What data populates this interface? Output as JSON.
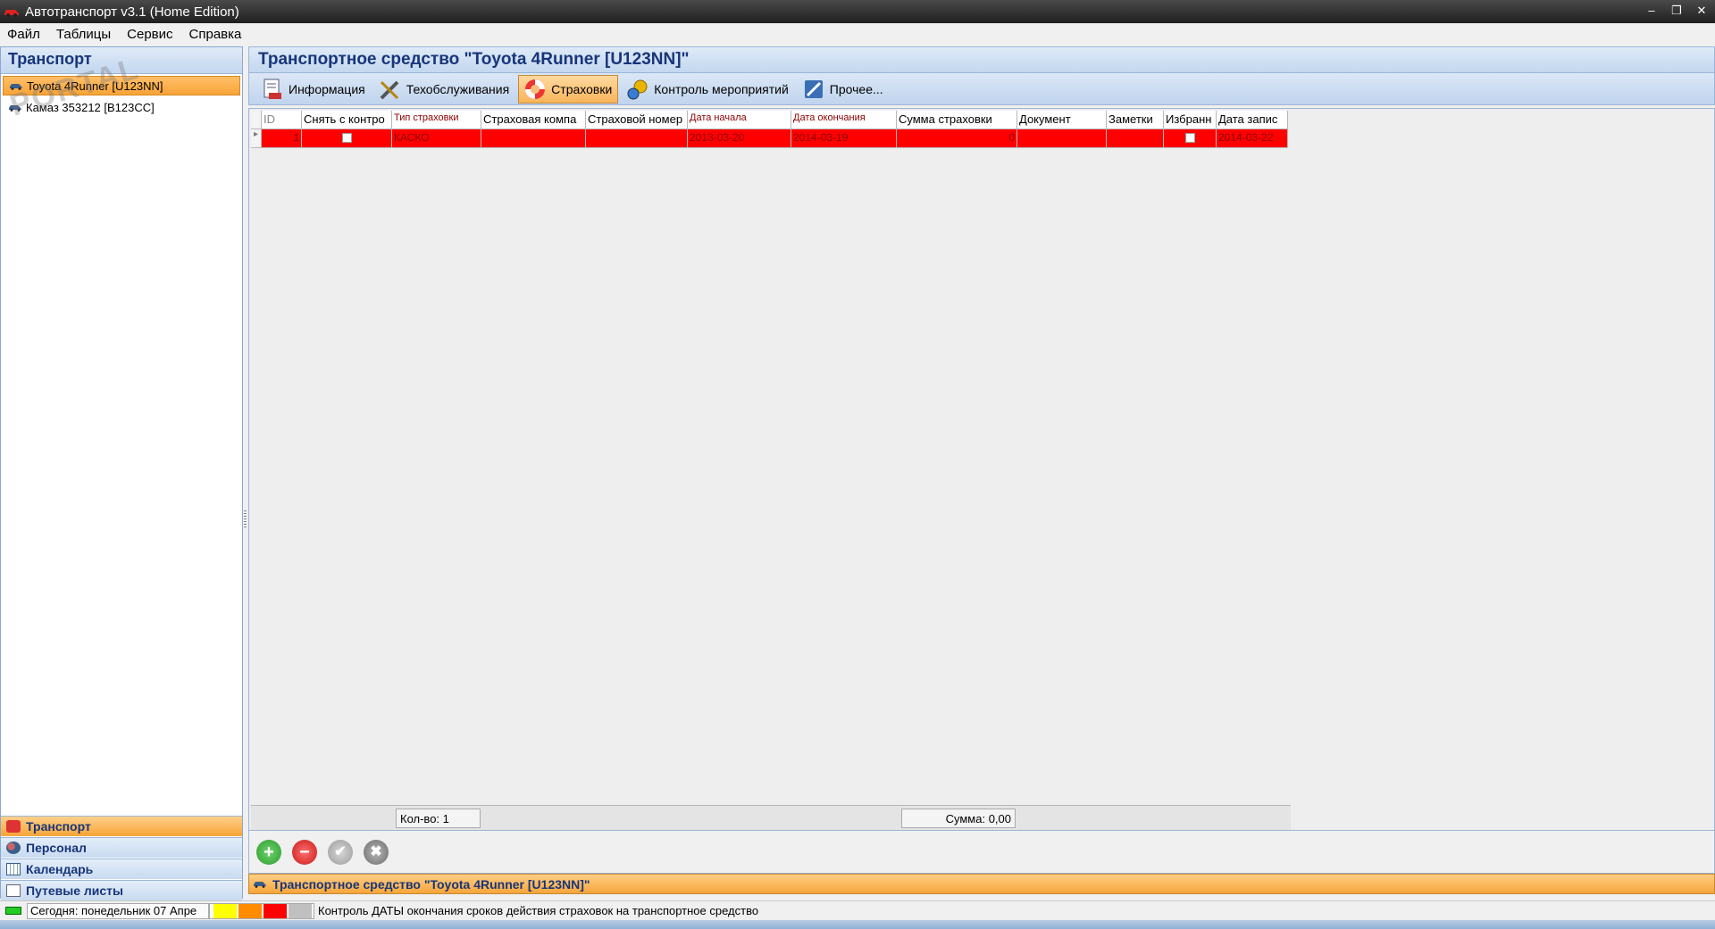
{
  "window": {
    "title": "Автотранспорт v3.1 (Home Edition)"
  },
  "menu": {
    "items": [
      "Файл",
      "Таблицы",
      "Сервис",
      "Справка"
    ]
  },
  "left": {
    "header": "Транспорт",
    "vehicles": [
      "Toyota 4Runner [U123NN]",
      "Камаз 353212 [B123CC]"
    ],
    "nav": [
      "Транспорт",
      "Персонал",
      "Календарь",
      "Путевые листы"
    ]
  },
  "right": {
    "header": "Транспортное средство \"Toyota 4Runner [U123NN]\"",
    "tabs": [
      "Информация",
      "Техобслуживания",
      "Страховки",
      "Контроль мероприятий",
      "Прочее..."
    ]
  },
  "grid": {
    "columns": [
      "ID",
      "Снять с контро",
      "Тип страховки",
      "Страховая компа",
      "Страховой номер",
      "Дата начала",
      "Дата окончания",
      "Сумма страховки",
      "Документ",
      "Заметки",
      "Избранн",
      "Дата запис"
    ],
    "row": {
      "id": "1",
      "type": "КАСКО",
      "company": "",
      "number": "",
      "start": "2013-03-20",
      "end": "2014-03-19",
      "sum": "0",
      "document": "",
      "notes": "",
      "created": "2014-03-22"
    },
    "footer": {
      "count": "Кол-во: 1",
      "sum": "Сумма: 0,00"
    }
  },
  "status_bottom": "Транспортное средство \"Toyota 4Runner [U123NN]\"",
  "statusbar": {
    "today": "Сегодня: понедельник 07 Апре",
    "message": "Контроль ДАТЫ окончания сроков действия страховок на транспортное средство",
    "swatches": [
      "#ffff00",
      "#ff8c00",
      "#ff0000",
      "#c0c0c0"
    ]
  },
  "watermark": "PORTAL"
}
